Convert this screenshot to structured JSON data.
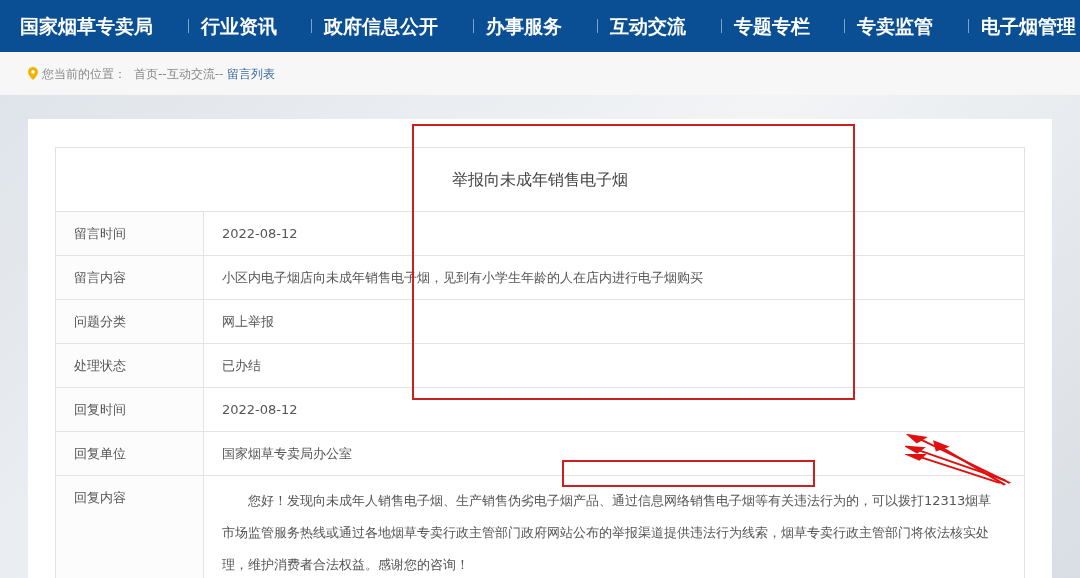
{
  "nav": {
    "items": [
      {
        "label": "国家烟草专卖局"
      },
      {
        "label": "行业资讯"
      },
      {
        "label": "政府信息公开"
      },
      {
        "label": "办事服务"
      },
      {
        "label": "互动交流"
      },
      {
        "label": "专题专栏"
      },
      {
        "label": "专卖监管"
      },
      {
        "label": "电子烟管理"
      }
    ]
  },
  "breadcrumb": {
    "prefix": "您当前的位置：",
    "path": "首页--互动交流--",
    "current": "留言列表"
  },
  "message": {
    "title": "举报向未成年销售电子烟",
    "rows": [
      {
        "label": "留言时间",
        "value": "2022-08-12"
      },
      {
        "label": "留言内容",
        "value": "小区内电子烟店向未成年销售电子烟，见到有小学生年龄的人在店内进行电子烟购买"
      },
      {
        "label": "问题分类",
        "value": "网上举报"
      },
      {
        "label": "处理状态",
        "value": "已办结"
      },
      {
        "label": "回复时间",
        "value": "2022-08-12"
      },
      {
        "label": "回复单位",
        "value": "国家烟草专卖局办公室"
      },
      {
        "label": "回复内容",
        "value": "您好！发现向未成年人销售电子烟、生产销售伪劣电子烟产品、通过信息网络销售电子烟等有关违法行为的，可以拨打12313烟草市场监管服务热线或通过各地烟草专卖行政主管部门政府网站公布的举报渠道提供违法行为线索，烟草专卖行政主管部门将依法核实处理，维护消费者合法权益。感谢您的咨询！"
      }
    ]
  }
}
